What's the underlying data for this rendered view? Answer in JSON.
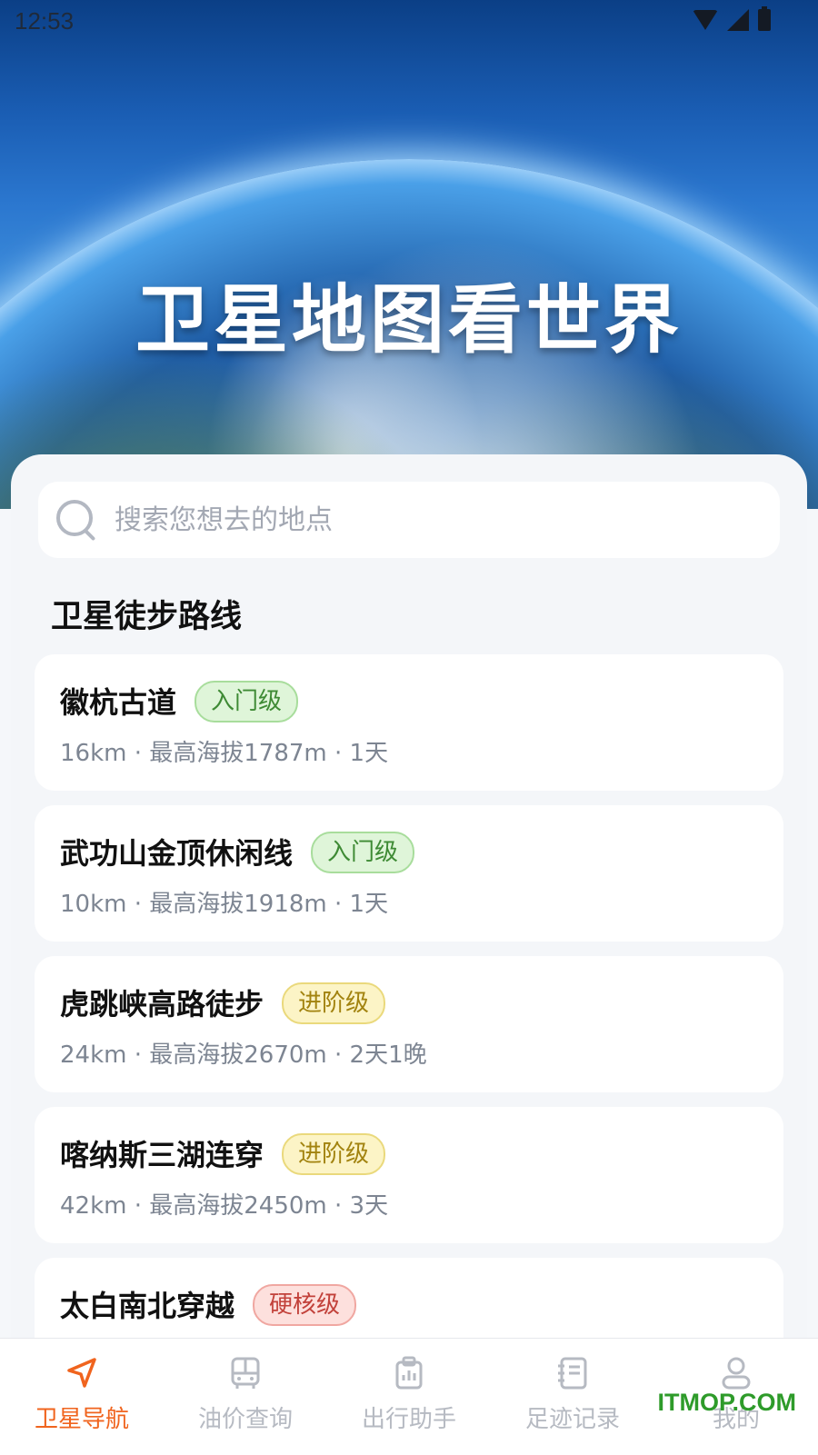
{
  "status": {
    "time": "12:53"
  },
  "hero": {
    "title": "卫星地图看世界"
  },
  "search": {
    "placeholder": "搜索您想去的地点"
  },
  "section": {
    "title": "卫星徒步路线"
  },
  "routes": [
    {
      "name": "徽杭古道",
      "level": "入门级",
      "level_color": "green",
      "info": "16km · 最高海拔1787m · 1天"
    },
    {
      "name": "武功山金顶休闲线",
      "level": "入门级",
      "level_color": "green",
      "info": "10km · 最高海拔1918m · 1天"
    },
    {
      "name": "虎跳峡高路徒步",
      "level": "进阶级",
      "level_color": "yellow",
      "info": "24km · 最高海拔2670m · 2天1晚"
    },
    {
      "name": "喀纳斯三湖连穿",
      "level": "进阶级",
      "level_color": "yellow",
      "info": "42km · 最高海拔2450m · 3天"
    },
    {
      "name": "太白南北穿越",
      "level": "硬核级",
      "level_color": "red",
      "info": ""
    }
  ],
  "tabs": [
    {
      "label": "卫星导航",
      "icon": "navigation-arrow-icon",
      "active": true
    },
    {
      "label": "油价查询",
      "icon": "bus-icon",
      "active": false
    },
    {
      "label": "出行助手",
      "icon": "clipboard-icon",
      "active": false
    },
    {
      "label": "足迹记录",
      "icon": "notebook-icon",
      "active": false
    },
    {
      "label": "我的",
      "icon": "person-icon",
      "active": false
    }
  ],
  "watermark": "ITMOP.COM",
  "colors": {
    "accent": "#f0641e",
    "inactive": "#b6bac2",
    "green": "#3e8a34",
    "yellow": "#a2830f",
    "red": "#c2413a"
  }
}
